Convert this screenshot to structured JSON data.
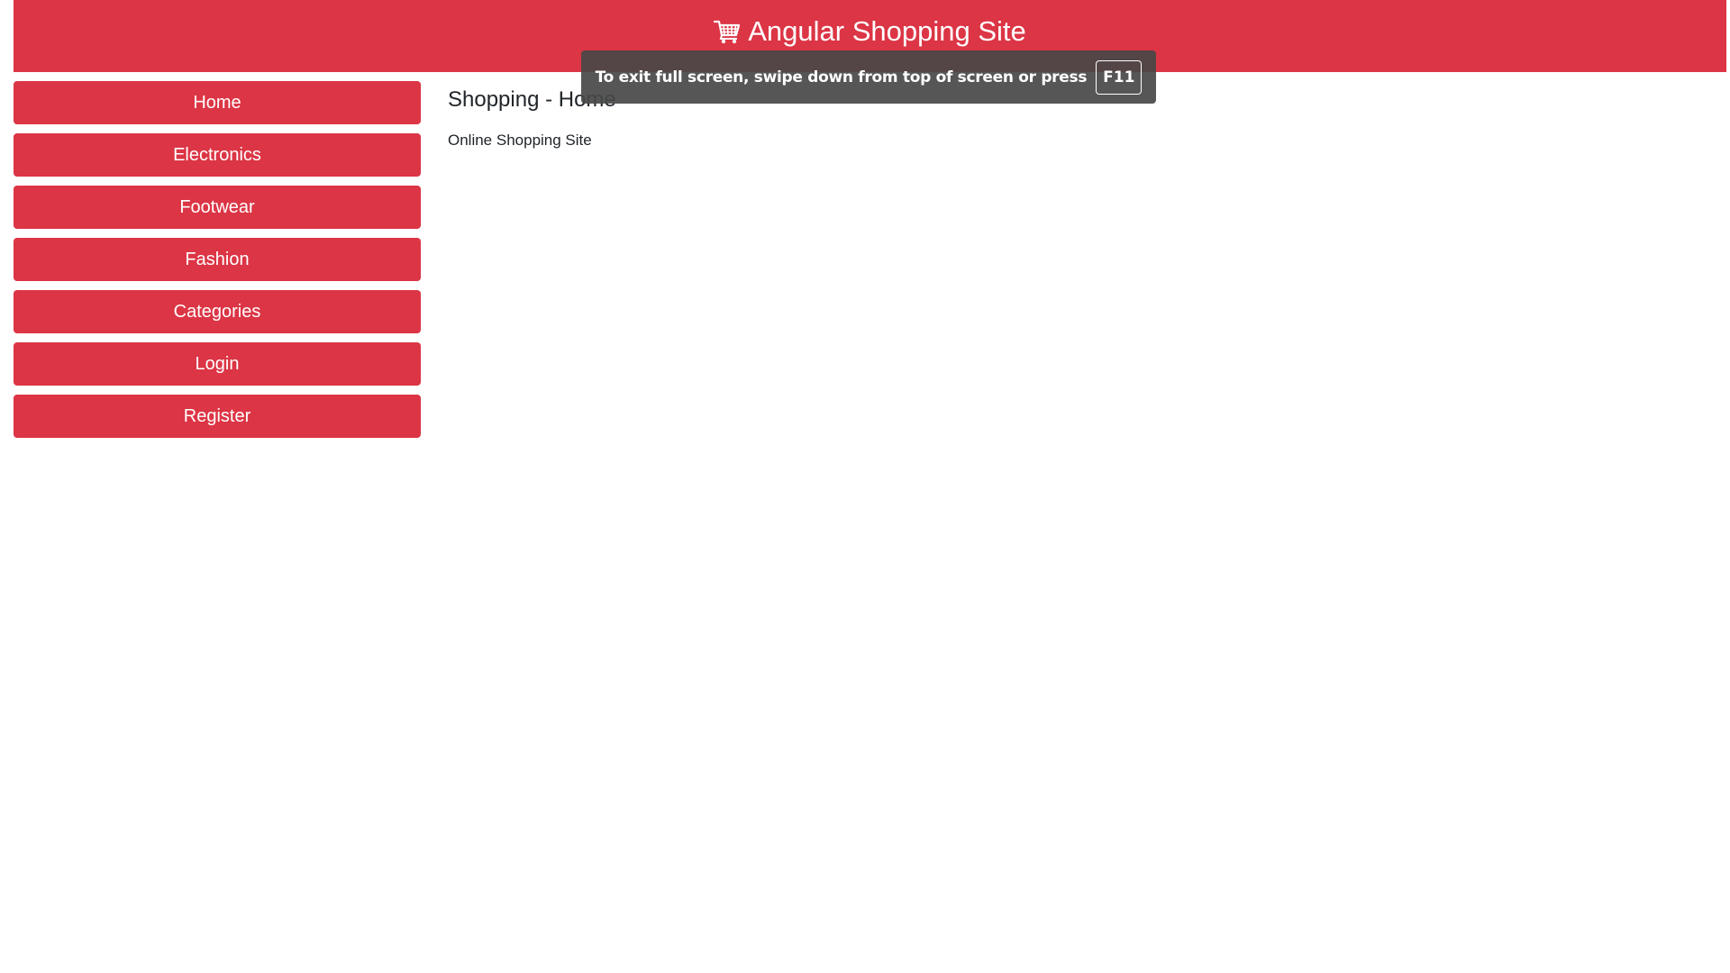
{
  "header": {
    "title": "Angular Shopping Site",
    "icon": "shopping-cart-icon",
    "background_color": "#dc3545"
  },
  "sidebar": {
    "items": [
      {
        "label": "Home"
      },
      {
        "label": "Electronics"
      },
      {
        "label": "Footwear"
      },
      {
        "label": "Fashion"
      },
      {
        "label": "Categories"
      },
      {
        "label": "Login"
      },
      {
        "label": "Register"
      }
    ],
    "button_color": "#dc3545"
  },
  "main": {
    "heading": "Shopping - Home",
    "text": "Online Shopping Site"
  },
  "fullscreen_notice": {
    "message": "To exit full screen, swipe down from top of screen or press",
    "key": "F11"
  }
}
